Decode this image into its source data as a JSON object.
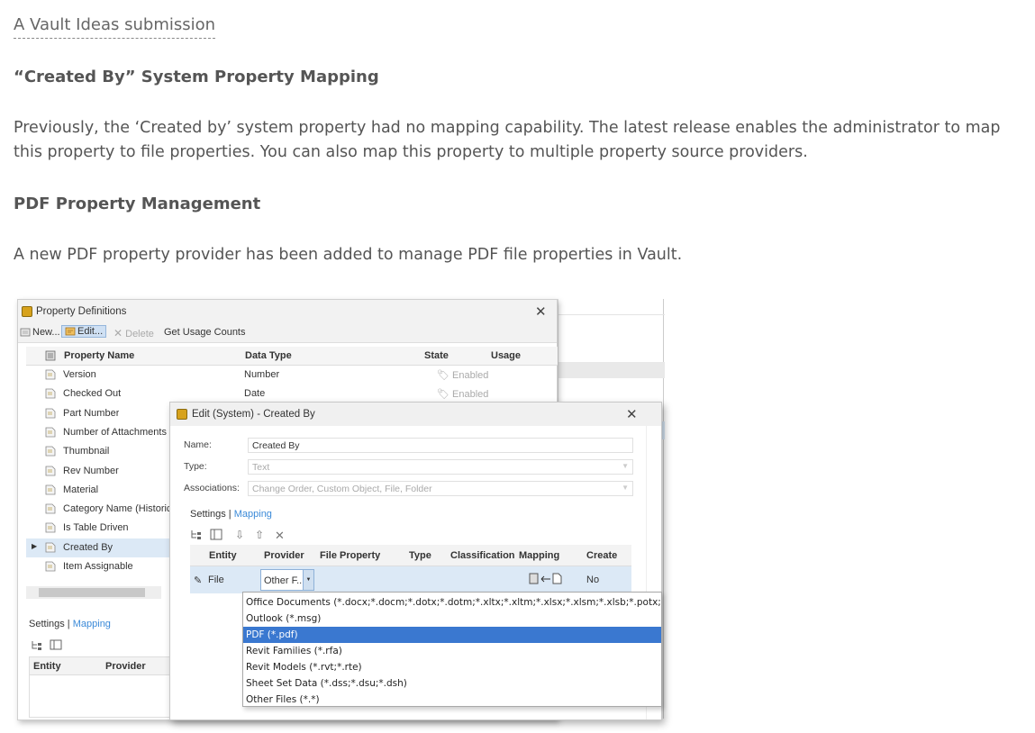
{
  "article": {
    "ideas_link": "A Vault Ideas submission",
    "heading1": "“Created By” System Property Mapping",
    "para1": "Previously, the ‘Created by’ system property had no mapping capability. The latest release enables the administrator to map this property to file properties. You can also map this property to multiple property source providers.",
    "heading2": "PDF Property Management",
    "para2": "A new PDF property provider has been added to manage PDF file properties in Vault."
  },
  "property_definitions": {
    "title": "Property Definitions",
    "toolbar": {
      "new": "New...",
      "edit": "Edit...",
      "delete": "Delete",
      "usage": "Get Usage Counts"
    },
    "columns": [
      "Property Name",
      "Data Type",
      "State",
      "Usage"
    ],
    "rows": [
      {
        "name": "Version",
        "type": "Number",
        "state": "Enabled"
      },
      {
        "name": "Checked Out",
        "type": "Date",
        "state": "Enabled"
      },
      {
        "name": "Part Number"
      },
      {
        "name": "Number of Attachments"
      },
      {
        "name": "Thumbnail"
      },
      {
        "name": "Rev Number"
      },
      {
        "name": "Material"
      },
      {
        "name": "Category Name (Historical)"
      },
      {
        "name": "Is Table Driven"
      },
      {
        "name": "Created By"
      },
      {
        "name": "Item Assignable"
      }
    ],
    "settings_label": "Settings |",
    "mapping_label": "Mapping",
    "lower_columns": [
      "Entity",
      "Provider"
    ]
  },
  "edit_dialog": {
    "title": "Edit (System) - Created By",
    "name_label": "Name:",
    "name_value": "Created By",
    "type_label": "Type:",
    "type_value": "Text",
    "assoc_label": "Associations:",
    "assoc_value": "Change Order, Custom Object, File, Folder",
    "settings_label": "Settings |",
    "mapping_label": "Mapping",
    "map_columns": [
      "Entity",
      "Provider",
      "File Property",
      "Type",
      "Classification",
      "Mapping",
      "Create"
    ],
    "map_row": {
      "entity": "File",
      "provider": "Other F...",
      "create": "No"
    }
  },
  "provider_dropdown": {
    "options": [
      "Office Documents (*.docx;*.docm;*.dotx;*.dotm;*.xltx;*.xltm;*.xlsx;*.xlsm;*.xlsb;*.potx;*.pptx;*.pptm",
      "Outlook (*.msg)",
      "PDF (*.pdf)",
      "Revit Families (*.rfa)",
      "Revit Models (*.rvt;*.rte)",
      "Sheet Set Data (*.dss;*.dsu;*.dsh)",
      "Other Files (*.*)"
    ],
    "selected_index": 2
  }
}
